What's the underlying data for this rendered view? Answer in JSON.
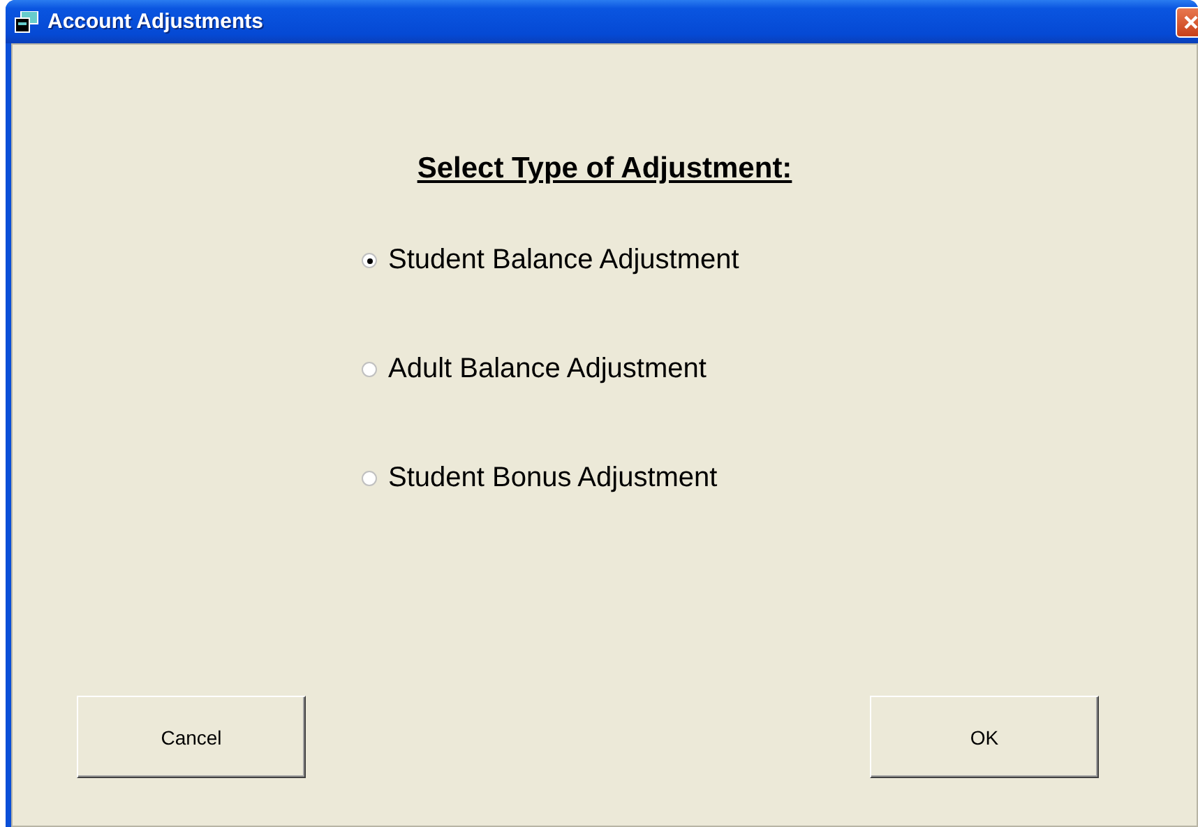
{
  "window": {
    "title": "Account Adjustments"
  },
  "heading": "Select Type of Adjustment:",
  "options": [
    {
      "label": "Student Balance Adjustment",
      "selected": true
    },
    {
      "label": "Adult Balance Adjustment",
      "selected": false
    },
    {
      "label": "Student Bonus Adjustment",
      "selected": false
    }
  ],
  "buttons": [
    "Cancel",
    "OK"
  ]
}
